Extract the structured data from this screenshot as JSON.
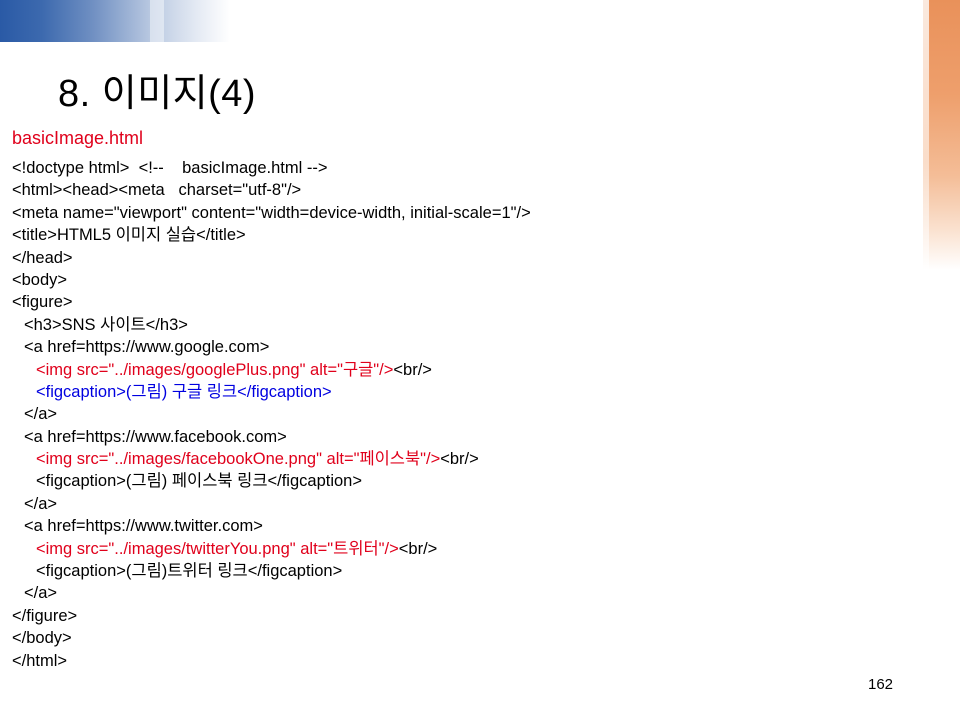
{
  "slide": {
    "title": "8. 이미지(4)",
    "file_label": "basicImage.html",
    "page_number": "162"
  },
  "code": [
    "<!doctype html>  <!--    basicImage.html -->",
    "<html><head><meta   charset=\"utf-8\"/>",
    "<meta name=\"viewport\" content=\"width=device-width, initial-scale=1\"/>",
    "<title>HTML5 이미지 실습</title>",
    "</head>",
    "<body>",
    "<figure>",
    "<h3>SNS 사이트</h3>",
    "<a href=https://www.google.com>",
    [
      "<img src=\"../images/googlePlus.png\" alt=\"구글\"/>",
      "<br/>"
    ],
    "<figcaption>(그림) 구글 링크</figcaption>",
    "</a>",
    "<a href=https://www.facebook.com>",
    [
      "<img src=\"../images/facebookOne.png\" alt=\"페이스북\"/>",
      "<br/>"
    ],
    "<figcaption>(그림) 페이스북 링크</figcaption>",
    "</a>",
    "<a href=https://www.twitter.com>",
    [
      "<img src=\"../images/twitterYou.png\" alt=\"트위터\"/>",
      "<br/>"
    ],
    "<figcaption>(그림)트위터 링크</figcaption>",
    "</a>",
    "</figure>",
    "</body>",
    "</html>"
  ],
  "colors": {
    "file_label": "#e0001b",
    "highlight_red": "#e0001b",
    "highlight_blue": "#0000e0",
    "top_band": "#2a5aa6",
    "side_band": "#e9915a"
  }
}
